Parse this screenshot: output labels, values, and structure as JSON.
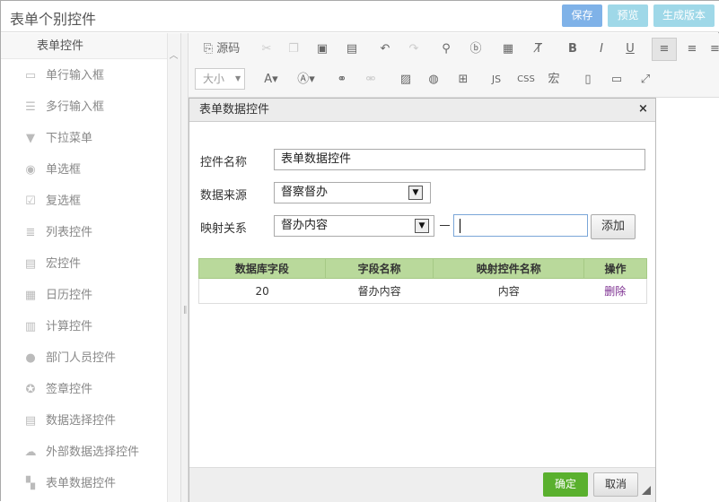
{
  "header": {
    "title": "表单个别控件",
    "save_label": "保存",
    "preview_label": "预览",
    "generate_label": "生成版本"
  },
  "sidebar": {
    "heading": "表单控件",
    "items": [
      {
        "label": "单行输入框",
        "icon": "text-line-icon",
        "glyph": "▭"
      },
      {
        "label": "多行输入框",
        "icon": "textarea-icon",
        "glyph": "☰"
      },
      {
        "label": "下拉菜单",
        "icon": "dropdown-icon",
        "glyph": "▼"
      },
      {
        "label": "单选框",
        "icon": "radio-icon",
        "glyph": "◉"
      },
      {
        "label": "复选框",
        "icon": "checkbox-icon",
        "glyph": "☑"
      },
      {
        "label": "列表控件",
        "icon": "list-icon",
        "glyph": "≣"
      },
      {
        "label": "宏控件",
        "icon": "macro-icon",
        "glyph": "▤"
      },
      {
        "label": "日历控件",
        "icon": "calendar-icon",
        "glyph": "▦"
      },
      {
        "label": "计算控件",
        "icon": "calculator-icon",
        "glyph": "▥"
      },
      {
        "label": "部门人员控件",
        "icon": "user-icon",
        "glyph": "●"
      },
      {
        "label": "签章控件",
        "icon": "seal-icon",
        "glyph": "✪"
      },
      {
        "label": "数据选择控件",
        "icon": "data-select-icon",
        "glyph": "▤"
      },
      {
        "label": "外部数据选择控件",
        "icon": "cloud-icon",
        "glyph": "☁"
      },
      {
        "label": "表单数据控件",
        "icon": "form-data-icon",
        "glyph": "▚"
      }
    ]
  },
  "toolbar": {
    "source_label": "源码",
    "font_size_label": "大小",
    "js_label": "JS",
    "css_label": "CSS",
    "macro_label": "宏"
  },
  "dialog": {
    "title": "表单数据控件",
    "close_glyph": "×",
    "name_label": "控件名称",
    "name_value": "表单数据控件",
    "source_label": "数据来源",
    "source_value": "督察督办",
    "mapping_label": "映射关系",
    "mapping_value": "督办内容",
    "mapping_target_value": "",
    "add_label": "添加",
    "table": {
      "headers": [
        "数据库字段",
        "字段名称",
        "映射控件名称",
        "操作"
      ],
      "rows": [
        {
          "db_field": "20",
          "field_name": "督办内容",
          "control_name": "内容",
          "action": "删除"
        }
      ]
    },
    "ok_label": "确定",
    "cancel_label": "取消"
  },
  "colors": {
    "save_button": "#7fb2e8",
    "table_header": "#b9d99b",
    "ok_button": "#5ab02e",
    "delete_link": "#7b2c8f"
  }
}
